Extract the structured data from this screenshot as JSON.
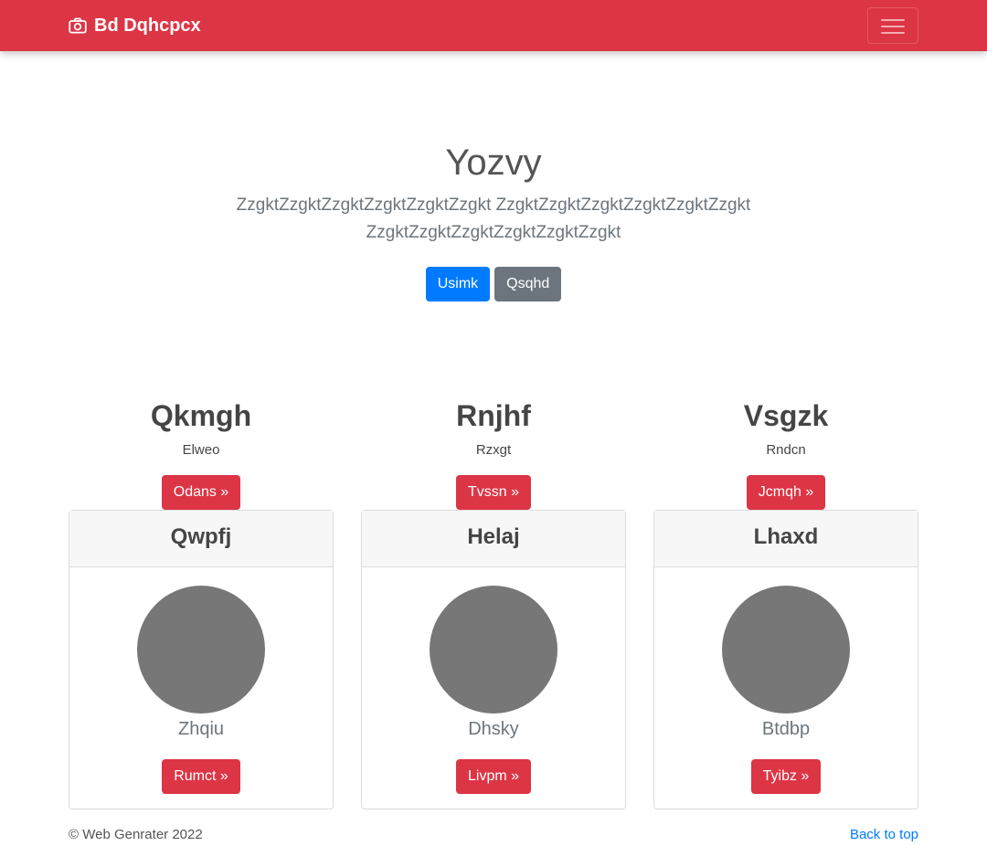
{
  "navbar": {
    "brand": "Bd Dqhcpcx",
    "brand_icon": "camera-icon",
    "accent_color": "#dc3545"
  },
  "hero": {
    "title": "Yozvy",
    "lead": "ZzgktZzgktZzgktZzgktZzgktZzgkt ZzgktZzgktZzgktZzgktZzgktZzgkt ZzgktZzgktZzgktZzgktZzgktZzgkt",
    "primary_btn": "Usimk",
    "secondary_btn": "Qsqhd"
  },
  "columns": [
    {
      "heading": "Qkmgh",
      "text": "Elweo",
      "button": "Odans »"
    },
    {
      "heading": "Rnjhf",
      "text": "Rzxgt",
      "button": "Tvssn »"
    },
    {
      "heading": "Vsgzk",
      "text": "Rndcn",
      "button": "Jcmqh »"
    }
  ],
  "cards": [
    {
      "title": "Qwpfj",
      "name": "Zhqiu",
      "button": "Rumct »"
    },
    {
      "title": "Helaj",
      "name": "Dhsky",
      "button": "Livpm »"
    },
    {
      "title": "Lhaxd",
      "name": "Btdbp",
      "button": "Tyibz »"
    }
  ],
  "footer": {
    "copyright": "© Web Genrater 2022",
    "back_to_top": "Back to top"
  }
}
